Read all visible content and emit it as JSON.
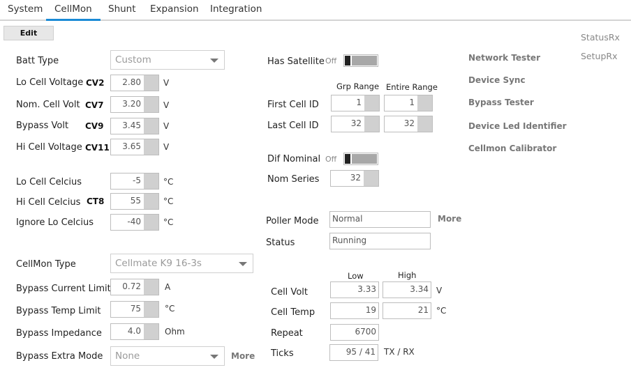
{
  "tabs": [
    "System",
    "CellMon",
    "Shunt",
    "Expansion",
    "Integration"
  ],
  "edit_label": "Edit",
  "left": {
    "batt_type": {
      "label": "Batt Type",
      "value": "Custom"
    },
    "lo_cell_voltage": {
      "label": "Lo Cell Voltage",
      "code": "CV2",
      "value": "2.80",
      "unit": "V"
    },
    "nom_cell_volt": {
      "label": "Nom. Cell Volt",
      "code": "CV7",
      "value": "3.20",
      "unit": "V"
    },
    "bypass_volt": {
      "label": "Bypass Volt",
      "code": "CV9",
      "value": "3.45",
      "unit": "V"
    },
    "hi_cell_voltage": {
      "label": "Hi Cell Voltage",
      "code": "CV11",
      "value": "3.65",
      "unit": "V"
    },
    "lo_cell_celcius": {
      "label": "Lo Cell Celcius",
      "value": "-5",
      "unit": "°C"
    },
    "hi_cell_celcius": {
      "label": "Hi Cell Celcius",
      "code": "CT8",
      "value": "55",
      "unit": "°C"
    },
    "ignore_lo_celcius": {
      "label": "Ignore Lo Celcius",
      "value": "-40",
      "unit": "°C"
    },
    "cellmon_type": {
      "label": "CellMon Type",
      "value": "Cellmate K9 16-3s"
    },
    "bypass_current_limit": {
      "label": "Bypass Current Limit",
      "value": "0.72",
      "unit": "A"
    },
    "bypass_temp_limit": {
      "label": "Bypass Temp Limit",
      "value": "75",
      "unit": "°C"
    },
    "bypass_impedance": {
      "label": "Bypass Impedance",
      "value": "4.0",
      "unit": "Ohm"
    },
    "bypass_extra_mode": {
      "label": "Bypass Extra Mode",
      "value": "None",
      "more": "More"
    }
  },
  "middle": {
    "has_satellite": {
      "label": "Has Satellite",
      "state": "Off"
    },
    "grp_range_header": "Grp Range",
    "entire_range_header": "Entire Range",
    "first_cell_id": {
      "label": "First Cell ID",
      "grp": "1",
      "entire": "1"
    },
    "last_cell_id": {
      "label": "Last Cell ID",
      "grp": "32",
      "entire": "32"
    },
    "dif_nominal": {
      "label": "Dif Nominal",
      "state": "Off"
    },
    "nom_series": {
      "label": "Nom Series",
      "value": "32"
    },
    "poller_mode": {
      "label": "Poller Mode",
      "value": "Normal",
      "more": "More"
    },
    "status": {
      "label": "Status",
      "value": "Running"
    },
    "low_header": "Low",
    "high_header": "High",
    "cell_volt": {
      "label": "Cell Volt",
      "low": "3.33",
      "high": "3.34",
      "unit": "V"
    },
    "cell_temp": {
      "label": "Cell Temp",
      "low": "19",
      "high": "21",
      "unit": "°C"
    },
    "repeat": {
      "label": "Repeat",
      "value": "6700"
    },
    "ticks": {
      "label": "Ticks",
      "value": "95 / 41",
      "unit": "TX / RX"
    }
  },
  "right": {
    "tools": [
      "Network Tester",
      "Device Sync",
      "Bypass Tester",
      "Device Led Identifier",
      "Cellmon Calibrator"
    ],
    "status_rx": "StatusRx",
    "setup_rx": "SetupRx"
  },
  "colors": {
    "accent": "#1a8ad6",
    "spinner": "#d0d0d0",
    "toggle_track": "#a8a8a8"
  }
}
